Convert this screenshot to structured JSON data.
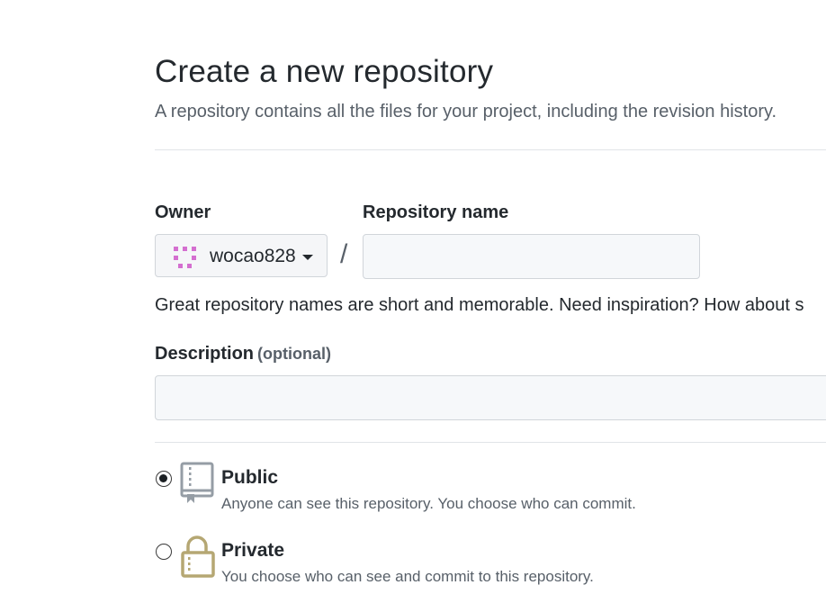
{
  "header": {
    "title": "Create a new repository",
    "subtitle": "A repository contains all the files for your project, including the revision history."
  },
  "form": {
    "owner": {
      "label": "Owner",
      "value": "wocao828",
      "avatar_color": "#d46fd0"
    },
    "separator": "/",
    "repository_name": {
      "label": "Repository name",
      "value": "",
      "placeholder": ""
    },
    "name_hint": "Great repository names are short and memorable. Need inspiration? How about s",
    "description": {
      "label": "Description",
      "optional": "(optional)",
      "value": "",
      "placeholder": ""
    },
    "visibility": {
      "selected": "public",
      "options": [
        {
          "id": "public",
          "title": "Public",
          "description": "Anyone can see this repository. You choose who can commit.",
          "icon": "repo-book-icon"
        },
        {
          "id": "private",
          "title": "Private",
          "description": "You choose who can see and commit to this repository.",
          "icon": "lock-icon"
        }
      ]
    }
  },
  "colors": {
    "text_primary": "#24292e",
    "text_secondary": "#586069",
    "border": "#d1d5da",
    "input_bg": "#f6f8fa",
    "public_icon": "#959da5",
    "private_icon": "#b5a773"
  }
}
